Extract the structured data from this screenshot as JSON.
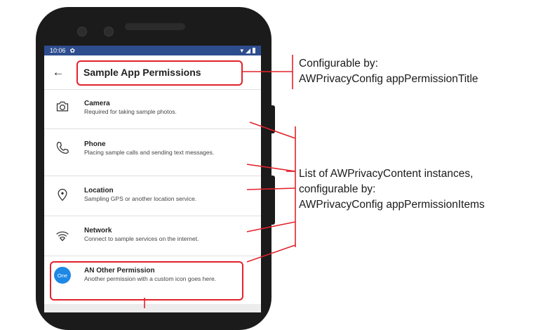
{
  "status": {
    "time": "10:06"
  },
  "appbar": {
    "title": "Sample App Permissions"
  },
  "permissions": [
    {
      "icon": "camera-icon",
      "name": "Camera",
      "desc": "Required for taking sample photos."
    },
    {
      "icon": "phone-icon",
      "name": "Phone",
      "desc": "Placing sample calls and sending text messages."
    },
    {
      "icon": "location-icon",
      "name": "Location",
      "desc": "Sampling GPS or another location service."
    },
    {
      "icon": "wifi-icon",
      "name": "Network",
      "desc": "Connect to sample services on the internet."
    },
    {
      "icon": "custom-one-icon",
      "icon_text": "One",
      "name": "AN Other Permission",
      "desc": "Another permission with a custom icon goes here."
    }
  ],
  "annotations": {
    "title_note": [
      "Configurable by:",
      "AWPrivacyConfig appPermissionTitle"
    ],
    "items_note": [
      "List of AWPrivacyContent instances,",
      "configurable by:",
      "AWPrivacyConfig appPermissionItems"
    ]
  },
  "colors": {
    "accent": "#e2222b",
    "statusbar": "#2e4d8f",
    "custom_icon": "#1e88e5"
  }
}
